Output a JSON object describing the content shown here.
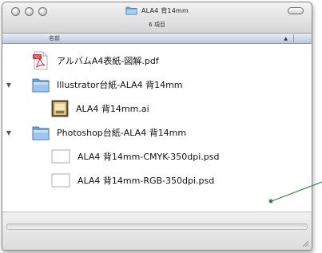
{
  "window": {
    "title": "ALA4 背14mm",
    "status_text": "6 項目",
    "column_header": "名前"
  },
  "rows": [
    {
      "label": "アルバムA4表紙-図解.pdf",
      "icon": "pdf-file-icon",
      "indent": 0,
      "disclosure": ""
    },
    {
      "label": "Illustrator台紙-ALA4 背14mm",
      "icon": "folder-icon",
      "indent": 0,
      "disclosure": "▼"
    },
    {
      "label": "ALA4 背14mm.ai",
      "icon": "illustrator-file-icon",
      "indent": 1,
      "disclosure": ""
    },
    {
      "label": "Photoshop台紙-ALA4 背14mm",
      "icon": "folder-icon",
      "indent": 0,
      "disclosure": "▼"
    },
    {
      "label": "ALA4 背14mm-CMYK-350dpi.psd",
      "icon": "blank-file-icon",
      "indent": 1,
      "disclosure": ""
    },
    {
      "label": "ALA4 背14mm-RGB-350dpi.psd",
      "icon": "blank-file-icon",
      "indent": 1,
      "disclosure": ""
    }
  ],
  "colors": {
    "annotation_line": "#2e8b3a",
    "folder_blue": "#6fa8dc",
    "header_blue": "#b9c8dc"
  }
}
